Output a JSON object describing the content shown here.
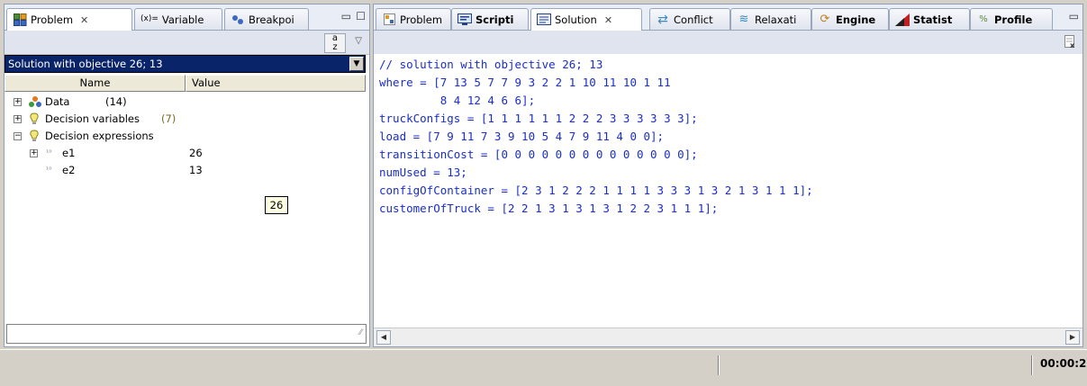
{
  "left_tabs": [
    {
      "label": "Problem",
      "icon": "problem-icon",
      "active": true,
      "close": "✕"
    },
    {
      "label": "Variable",
      "icon": "variable-icon",
      "prefix": "(x)=",
      "active": false
    },
    {
      "label": "Breakpoi",
      "icon": "breakpoint-icon",
      "active": false
    }
  ],
  "combo": {
    "value": "Solution with objective 26; 13"
  },
  "columns": {
    "name": "Name",
    "value": "Value"
  },
  "tree": [
    {
      "label": "Data",
      "count": "(14)",
      "expander": "+"
    },
    {
      "label": "Decision variables",
      "count": "(7)",
      "expander": "+"
    },
    {
      "label": "Decision expressions",
      "count": "",
      "expander": "−"
    },
    {
      "label": "e1",
      "value": "26",
      "expander": "+"
    },
    {
      "label": "e2",
      "value": "13",
      "expander": ""
    }
  ],
  "tooltip": "26",
  "right_tabs": [
    {
      "label": "Problem",
      "icon": "problem-icon",
      "bold": false
    },
    {
      "label": "Scripti",
      "icon": "script-icon",
      "bold": true
    },
    {
      "label": "Solution",
      "icon": "solution-icon",
      "bold": false,
      "active": true,
      "close": "✕"
    },
    {
      "label": "Conflict",
      "icon": "conflict-icon",
      "bold": false
    },
    {
      "label": "Relaxati",
      "icon": "relaxation-icon",
      "bold": false
    },
    {
      "label": "Engine",
      "icon": "engine-icon",
      "bold": true
    },
    {
      "label": "Statist",
      "icon": "statistics-icon",
      "bold": true
    },
    {
      "label": "Profile",
      "icon": "profile-icon",
      "bold": true
    }
  ],
  "code_lines": [
    "// solution with objective 26; 13",
    "where = [7 13 5 7 7 9 3 2 2 1 10 11 10 1 11",
    "         8 4 12 4 6 6];",
    "truckConfigs = [1 1 1 1 1 1 2 2 2 3 3 3 3 3 3];",
    "load = [7 9 11 7 3 9 10 5 4 7 9 11 4 0 0];",
    "transitionCost = [0 0 0 0 0 0 0 0 0 0 0 0 0 0];",
    "numUsed = 13;",
    "configOfContainer = [2 3 1 2 2 2 1 1 1 1 3 3 3 1 3 2 1 3 1 1 1];",
    "customerOfTruck = [2 2 1 3 1 3 1 3 1 2 2 3 1 1 1];"
  ],
  "status": {
    "timer": "00:00:2"
  },
  "colors": {
    "code": "#1a2ec8",
    "selection": "#0a246a",
    "tooltip_bg": "#ffffe1"
  }
}
